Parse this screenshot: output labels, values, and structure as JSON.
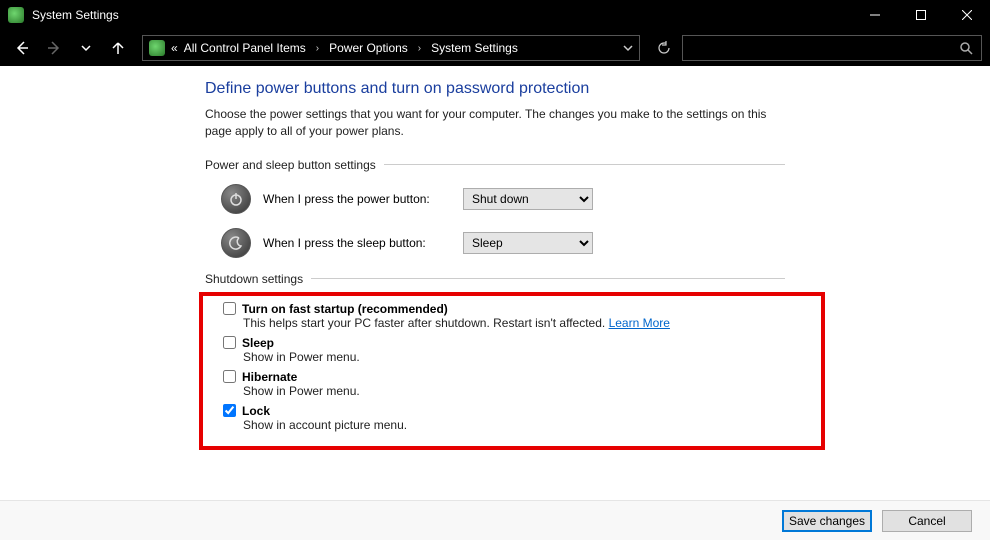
{
  "window": {
    "title": "System Settings"
  },
  "breadcrumb": {
    "prefix": "«",
    "items": [
      "All Control Panel Items",
      "Power Options",
      "System Settings"
    ]
  },
  "page": {
    "title": "Define power buttons and turn on password protection",
    "description": "Choose the power settings that you want for your computer. The changes you make to the settings on this page apply to all of your power plans."
  },
  "sections": {
    "button_settings": {
      "label": "Power and sleep button settings",
      "rows": [
        {
          "label": "When I press the power button:",
          "value": "Shut down"
        },
        {
          "label": "When I press the sleep button:",
          "value": "Sleep"
        }
      ]
    },
    "shutdown_settings": {
      "label": "Shutdown settings",
      "items": [
        {
          "checked": false,
          "name": "Turn on fast startup (recommended)",
          "sub": "This helps start your PC faster after shutdown. Restart isn't affected.",
          "link": "Learn More"
        },
        {
          "checked": false,
          "name": "Sleep",
          "sub": "Show in Power menu."
        },
        {
          "checked": false,
          "name": "Hibernate",
          "sub": "Show in Power menu."
        },
        {
          "checked": true,
          "name": "Lock",
          "sub": "Show in account picture menu."
        }
      ]
    }
  },
  "footer": {
    "save": "Save changes",
    "cancel": "Cancel"
  }
}
